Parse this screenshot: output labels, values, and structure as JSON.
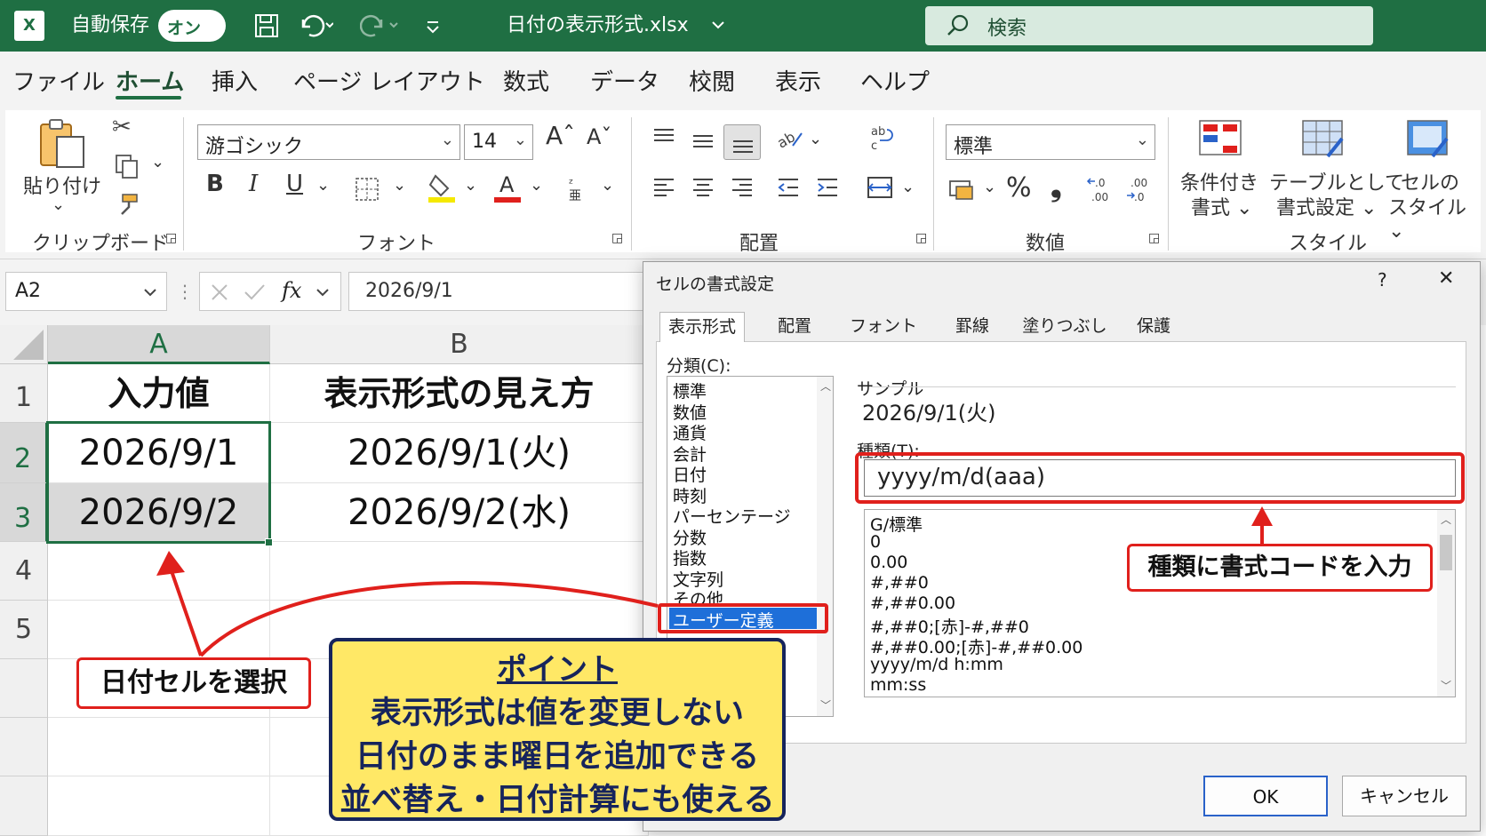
{
  "titlebar": {
    "logo": "X",
    "autosave_label": "自動保存",
    "autosave_state": "オン",
    "filename": "日付の表示形式.xlsx",
    "search_placeholder": "検索"
  },
  "menu": [
    "ファイル",
    "ホーム",
    "挿入",
    "ページ レイアウト",
    "数式",
    "データ",
    "校閲",
    "表示",
    "ヘルプ"
  ],
  "ribbon": {
    "clipboard": {
      "paste": "貼り付け",
      "group": "クリップボード"
    },
    "font": {
      "name": "游ゴシック",
      "size": "14",
      "bold": "B",
      "italic": "I",
      "underline": "U",
      "group": "フォント"
    },
    "alignment": {
      "group": "配置"
    },
    "number": {
      "format": "標準",
      "percent": "%",
      "comma": "❟",
      "group": "数値"
    },
    "styles": {
      "conditional": [
        "条件付き",
        "書式 ⌄"
      ],
      "table": [
        "テーブルとして",
        "書式設定 ⌄"
      ],
      "cell": [
        "セルの",
        "スタイル ⌄"
      ],
      "group": "スタイル"
    }
  },
  "formula_bar": {
    "name_box": "A2",
    "fx": "fx",
    "formula": "2026/9/1"
  },
  "grid": {
    "columns": [
      "A",
      "B"
    ],
    "rows": [
      "1",
      "2",
      "3",
      "4",
      "5"
    ],
    "header": [
      "入力値",
      "表示形式の見え方"
    ],
    "data": [
      [
        "2026/9/1",
        "2026/9/1(火)"
      ],
      [
        "2026/9/2",
        "2026/9/2(水)"
      ]
    ]
  },
  "dialog": {
    "title": "セルの書式設定",
    "help": "?",
    "close": "✕",
    "tabs": [
      "表示形式",
      "配置",
      "フォント",
      "罫線",
      "塗りつぶし",
      "保護"
    ],
    "category_label": "分類(C):",
    "categories": [
      "標準",
      "数値",
      "通貨",
      "会計",
      "日付",
      "時刻",
      "パーセンテージ",
      "分数",
      "指数",
      "文字列",
      "その他",
      "ユーザー定義"
    ],
    "selected_category": "ユーザー定義",
    "sample_label": "サンプル",
    "sample_value": "2026/9/1(火)",
    "type_label": "種類(T):",
    "type_value": "yyyy/m/d(aaa)",
    "type_list": [
      "G/標準",
      "0",
      "0.00",
      "#,##0",
      "#,##0.00",
      "#,##0;[赤]-#,##0",
      "#,##0.00;[赤]-#,##0.00",
      "yyyy/m/d h:mm",
      "mm:ss"
    ],
    "ok": "OK",
    "cancel": "キャンセル"
  },
  "annotations": {
    "select_cell": "日付セルを選択",
    "type_hint": "種類に書式コードを入力",
    "point_title": "ポイント",
    "point_lines": [
      "表示形式は値を変更しない",
      "日付のまま曜日を追加できる",
      "並べ替え・日付計算にも使える"
    ]
  },
  "colors": {
    "excel_green": "#1f6f43",
    "annotation_red": "#e0201c",
    "point_yellow": "#ffe866",
    "point_navy": "#16245c",
    "selection_blue": "#1e6fd9"
  }
}
